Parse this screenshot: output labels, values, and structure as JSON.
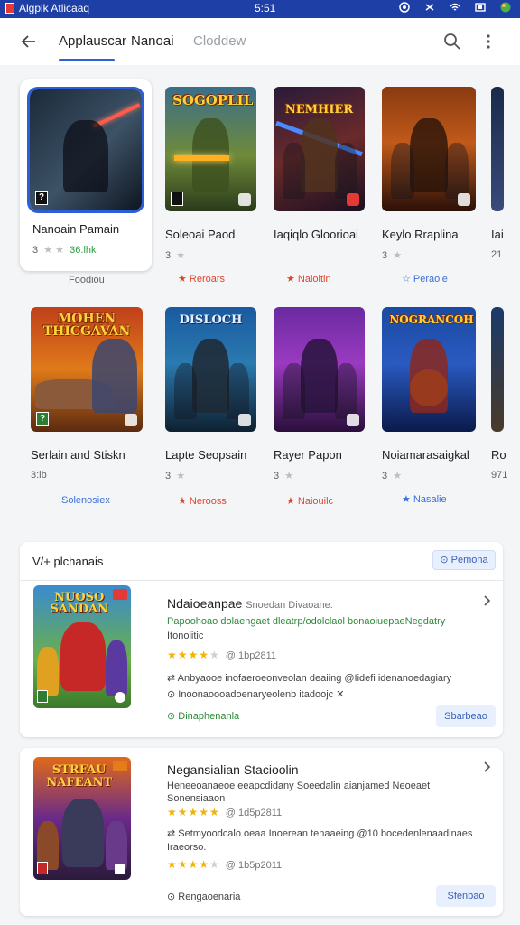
{
  "status_bar": {
    "app_name": "Algplk Atlicaaq",
    "time": "5:51"
  },
  "app_bar": {
    "tabs": [
      "Applauscar",
      "Nanoai",
      "Cloddew"
    ]
  },
  "games": [
    {
      "name": "Nanoain Pamain",
      "meta": "3",
      "meta_stars": "★ ★",
      "meta_extra": "36.lhk",
      "tag": "Foodiou",
      "tag_style": "gray",
      "logo": "",
      "badge": "?"
    },
    {
      "name": "Soleoai Paod",
      "meta": "3",
      "meta_stars": "★",
      "meta_extra": "",
      "tag": "Reroars",
      "tag_style": "red",
      "logo": "SOGOPLIL",
      "badge": ""
    },
    {
      "name": "Iaqiqlo Gloorioai",
      "meta": "",
      "meta_stars": "",
      "meta_extra": "",
      "tag": "Naioitin",
      "tag_style": "red",
      "logo": "NEMHIER",
      "badge": ""
    },
    {
      "name": "Keylo Rraplina",
      "meta": "3",
      "meta_stars": "★",
      "meta_extra": "",
      "tag": "Peraole",
      "tag_style": "blue",
      "logo": "",
      "badge": ""
    },
    {
      "name": "Iai",
      "meta": "21",
      "meta_stars": "",
      "meta_extra": "",
      "tag": "",
      "tag_style": "gray",
      "logo": "",
      "badge": ""
    },
    {
      "name": "Serlain and Stiskn",
      "meta": "3:lb",
      "meta_stars": "",
      "meta_extra": "",
      "tag": "Solenosiex",
      "tag_style": "blue",
      "logo": "MOHEN THICGAVAN",
      "badge": "?"
    },
    {
      "name": "Lapte Seopsain",
      "meta": "3",
      "meta_stars": "★",
      "meta_extra": "",
      "tag": "Nerooss",
      "tag_style": "red",
      "logo": "DISLOCH",
      "badge": ""
    },
    {
      "name": "Rayer Papon",
      "meta": "3",
      "meta_stars": "★",
      "meta_extra": "",
      "tag": "Naiouilc",
      "tag_style": "red",
      "logo": "",
      "badge": ""
    },
    {
      "name": "Noiamarasaigkal",
      "meta": "3",
      "meta_stars": "★",
      "meta_extra": "",
      "tag": "Nasalie",
      "tag_style": "blue",
      "logo": "NOGRANCOH",
      "badge": ""
    },
    {
      "name": "Ro",
      "meta": "971",
      "meta_stars": "",
      "meta_extra": "",
      "tag": "",
      "tag_style": "gray",
      "logo": "",
      "badge": ""
    }
  ],
  "section": {
    "title": "V/+ plchanais",
    "button": "Pemona",
    "item1": {
      "image_logo": "NUOSO SANDAN",
      "title": "Ndaioeanpae",
      "title_sub": "Snoedan Divaoane.",
      "line1": "Papoohoao dolaengaet dleatrp/odolclaol bonaoiuepaeNegdatry",
      "line2": "Itonolitic",
      "rating_count": "@ 1bp2811",
      "detail1": "Anbyaooe inofaeroeonveolan deaiing @Iidefi idenanoedagiary",
      "detail2": "Inoonaoooadoenaryeolenb itadoojc",
      "status": "Dinaphenanla",
      "button": "Sbarbeao"
    },
    "item2": {
      "image_logo": "STRFAU NAFEANT",
      "title": "Negansialian Stacioolin",
      "line1": "Heneeoanaeoe eeapcdidany Soeedalin aianjamed Neoeaet",
      "line2": "Sonensiaaon",
      "rating_count": "@ 1d5p2811",
      "detail1": "Setmyoodcalo oeaa Inoerean tenaaeing @10 bocedenlenaadinaes",
      "detail2": "Iraeorso.",
      "rating_count2": "@ 1b5p2011",
      "status": "Rengaoenaria",
      "button": "Sfenbao"
    }
  },
  "colors": {
    "accent": "#2b5ed8",
    "status_bar": "#1e3fa6",
    "star": "#f2b400",
    "green": "#2e8b3a",
    "red_tag": "#e0452b"
  },
  "icons": [
    "back-arrow-icon",
    "search-icon",
    "more-vert-icon",
    "chevron-right-icon",
    "star-icon",
    "check-circle-icon",
    "wifi-icon",
    "battery-icon"
  ]
}
